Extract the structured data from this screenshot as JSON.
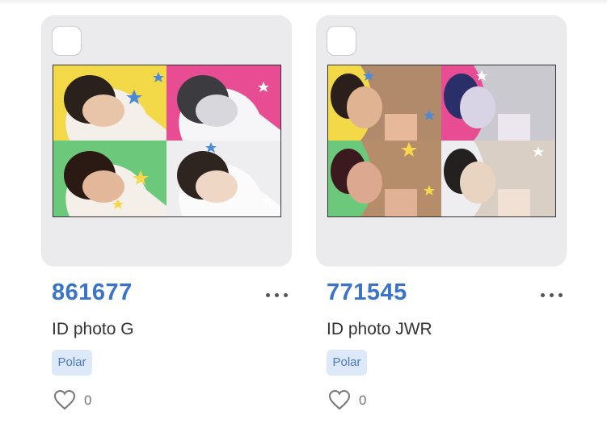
{
  "cards": [
    {
      "code": "861677",
      "title": "ID photo G",
      "tag": "Polar",
      "likes": "0",
      "panel_colors": [
        "#f3d847",
        "#e84c93",
        "#6cc87a",
        "#d9d6dc"
      ]
    },
    {
      "code": "771545",
      "title": "ID photo JWR",
      "tag": "Polar",
      "likes": "0",
      "panel_colors": [
        "#f3d847",
        "#e84c93",
        "#6cc87a",
        "#d9d6dc"
      ]
    }
  ],
  "colors": {
    "card_bg": "#ebebee",
    "accent": "#3a73c8",
    "tag_bg": "#dde8f8"
  },
  "icons": {
    "checkbox": "checkbox-icon",
    "more": "more-dots-icon",
    "like": "heart-icon"
  }
}
